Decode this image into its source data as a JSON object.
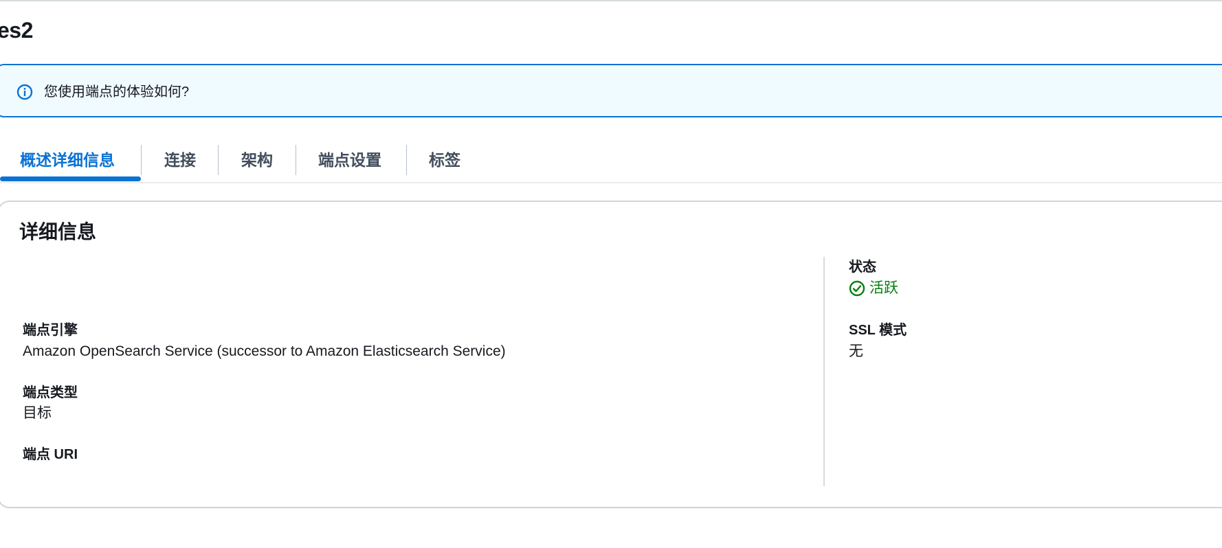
{
  "page": {
    "title": "es2"
  },
  "banner": {
    "icon": "info-icon",
    "text": "您使用端点的体验如何?"
  },
  "tabs": [
    {
      "label": "概述详细信息",
      "active": true
    },
    {
      "label": "连接",
      "active": false
    },
    {
      "label": "架构",
      "active": false
    },
    {
      "label": "端点设置",
      "active": false
    },
    {
      "label": "标签",
      "active": false
    }
  ],
  "details": {
    "title": "详细信息",
    "engine_label": "端点引擎",
    "engine_value": "Amazon OpenSearch Service (successor to Amazon Elasticsearch Service)",
    "type_label": "端点类型",
    "type_value": "目标",
    "uri_label": "端点 URI",
    "uri_value": "",
    "status_label": "状态",
    "status_icon": "check-circle-icon",
    "status_value": "活跃",
    "ssl_label": "SSL 模式",
    "ssl_value": "无"
  },
  "colors": {
    "accent": "#0972d3",
    "success": "#037f0c",
    "banner_bg": "#f0fbff"
  }
}
